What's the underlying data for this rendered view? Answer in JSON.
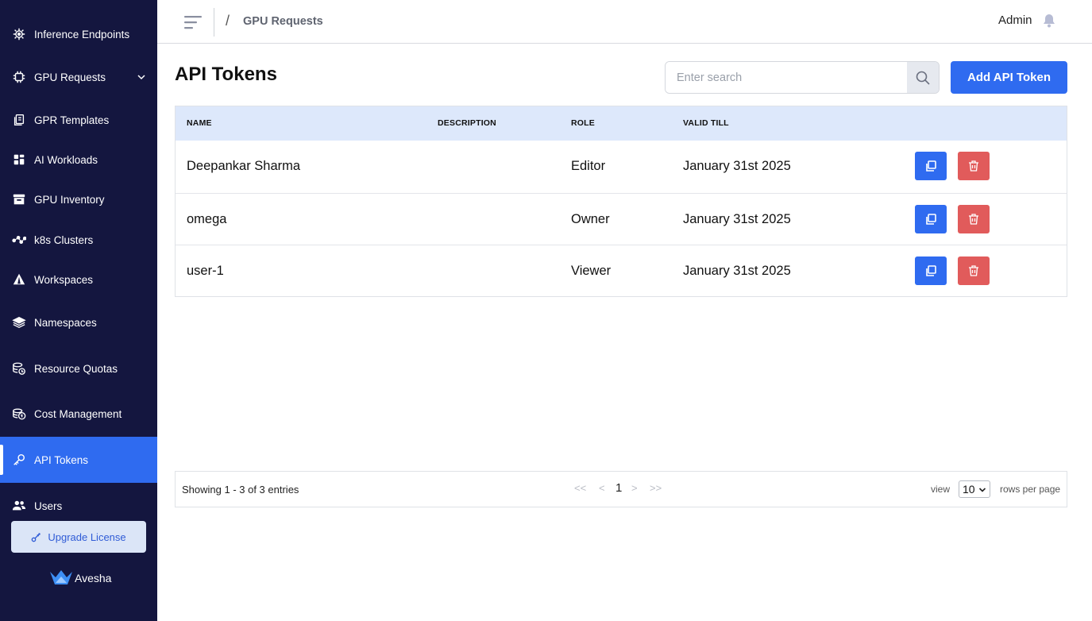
{
  "sidebar": {
    "items": [
      {
        "label": "Inference Endpoints",
        "icon": "chip-icon"
      },
      {
        "label": "GPU Requests",
        "icon": "cpu-icon",
        "expandable": true
      },
      {
        "label": "GPR Templates",
        "icon": "template-icon"
      },
      {
        "label": "AI Workloads",
        "icon": "dashboard-icon"
      },
      {
        "label": "GPU Inventory",
        "icon": "archive-icon"
      },
      {
        "label": "k8s Clusters",
        "icon": "cluster-icon"
      },
      {
        "label": "Workspaces",
        "icon": "pyramid-icon"
      },
      {
        "label": "Namespaces",
        "icon": "layers-icon"
      },
      {
        "label": "Resource Quotas",
        "icon": "quota-icon"
      },
      {
        "label": "Cost Management",
        "icon": "coins-icon"
      },
      {
        "label": "API Tokens",
        "icon": "key-icon",
        "active": true
      },
      {
        "label": "Users",
        "icon": "users-icon"
      }
    ],
    "upgrade_label": "Upgrade License",
    "brand": "Avesha"
  },
  "header": {
    "separator": "/",
    "breadcrumb": "GPU Requests",
    "user": "Admin"
  },
  "main": {
    "title": "API Tokens",
    "search_placeholder": "Enter search",
    "add_button": "Add API Token",
    "columns": [
      "NAME",
      "DESCRIPTION",
      "ROLE",
      "VALID TILL"
    ],
    "rows": [
      {
        "name": "Deepankar Sharma",
        "description": "",
        "role": "Editor",
        "valid_till": "January 31st 2025"
      },
      {
        "name": "omega",
        "description": "",
        "role": "Owner",
        "valid_till": "January 31st 2025"
      },
      {
        "name": "user-1",
        "description": "",
        "role": "Viewer",
        "valid_till": "January 31st 2025"
      }
    ]
  },
  "pagination": {
    "info": "Showing 1 - 3 of 3 entries",
    "first": "<<",
    "prev": "<",
    "current": "1",
    "next": ">",
    "last": ">>",
    "view_label": "view",
    "rows_per_page": "10",
    "rows_label": "rows per page"
  },
  "colors": {
    "sidebar_bg": "#14163f",
    "accent": "#2f6bf0",
    "danger": "#e15b5b",
    "table_header_bg": "#dde8fb"
  }
}
